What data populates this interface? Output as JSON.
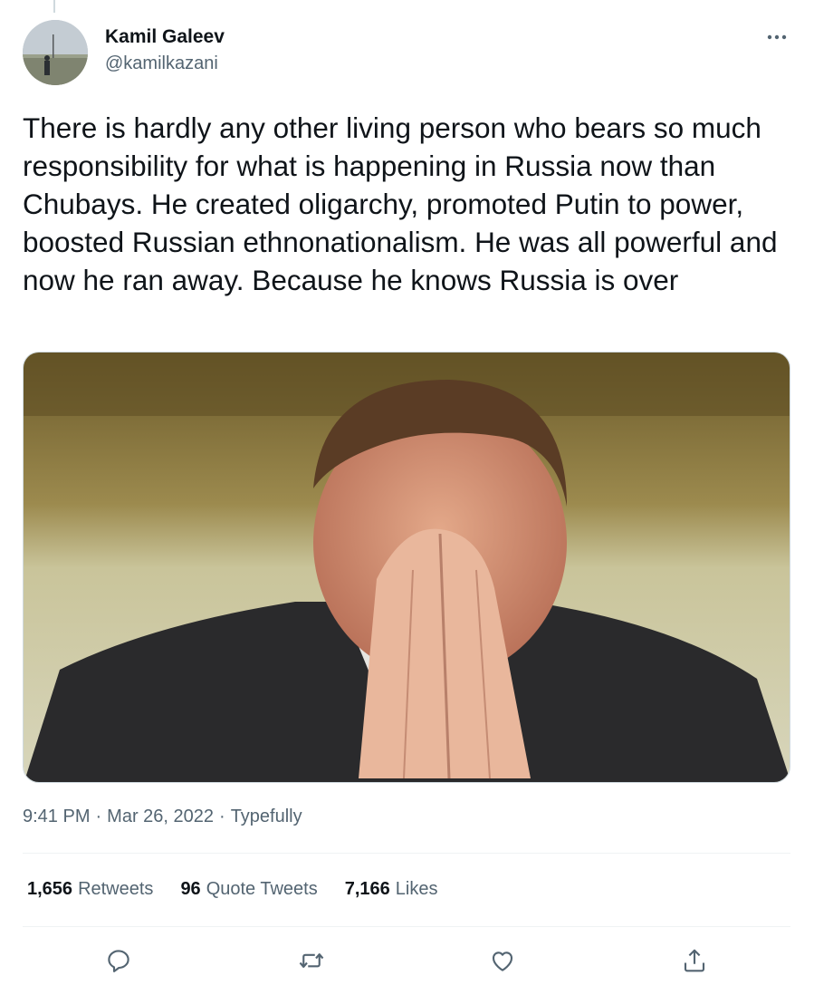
{
  "author": {
    "name": "Kamil Galeev",
    "handle": "@kamilkazani"
  },
  "tweet": {
    "text": "There is hardly any other living person who bears so much  responsibility for what is happening in Russia now than Chubays. He created oligarchy, promoted Putin to power, boosted Russian ethnonationalism. He was all powerful and now he ran away. Because he knows Russia is over"
  },
  "meta": {
    "time": "9:41 PM",
    "separator": "·",
    "date": "Mar 26, 2022",
    "source": "Typefully"
  },
  "stats": [
    {
      "count": "1,656",
      "label": "Retweets"
    },
    {
      "count": "96",
      "label": "Quote Tweets"
    },
    {
      "count": "7,166",
      "label": "Likes"
    }
  ],
  "icons": {
    "more": "more-dots-icon",
    "reply": "reply-icon",
    "retweet": "retweet-icon",
    "like": "heart-icon",
    "share": "share-icon"
  },
  "colors": {
    "text": "#0f1419",
    "secondary": "#536471",
    "divider": "#eff3f4",
    "icon": "#536471"
  }
}
